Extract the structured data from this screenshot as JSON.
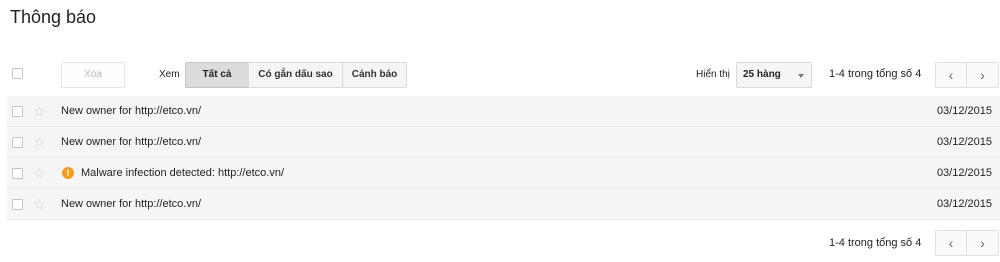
{
  "page": {
    "title": "Thông báo"
  },
  "toolbar": {
    "delete_label": "Xóa",
    "view_label": "Xem",
    "filters": [
      {
        "label": "Tất cả",
        "active": true
      },
      {
        "label": "Có gắn dấu sao",
        "active": false
      },
      {
        "label": "Cảnh báo",
        "active": false
      }
    ],
    "show_label": "Hiển thị",
    "rows_per_page": "25 hàng",
    "pagination": "1-4 trong tổng số 4",
    "prev_icon": "‹",
    "next_icon": "›"
  },
  "messages": [
    {
      "subject": "New owner for http://etco.vn/",
      "date": "03/12/2015",
      "warning": false
    },
    {
      "subject": "New owner for http://etco.vn/",
      "date": "03/12/2015",
      "warning": false
    },
    {
      "subject": "Malware infection detected: http://etco.vn/",
      "date": "03/12/2015",
      "warning": true
    },
    {
      "subject": "New owner for http://etco.vn/",
      "date": "03/12/2015",
      "warning": false
    }
  ],
  "footer": {
    "pagination": "1-4 trong tổng số 4"
  },
  "colors": {
    "warning": "#f29d1d",
    "row_bg": "#f5f5f5"
  }
}
